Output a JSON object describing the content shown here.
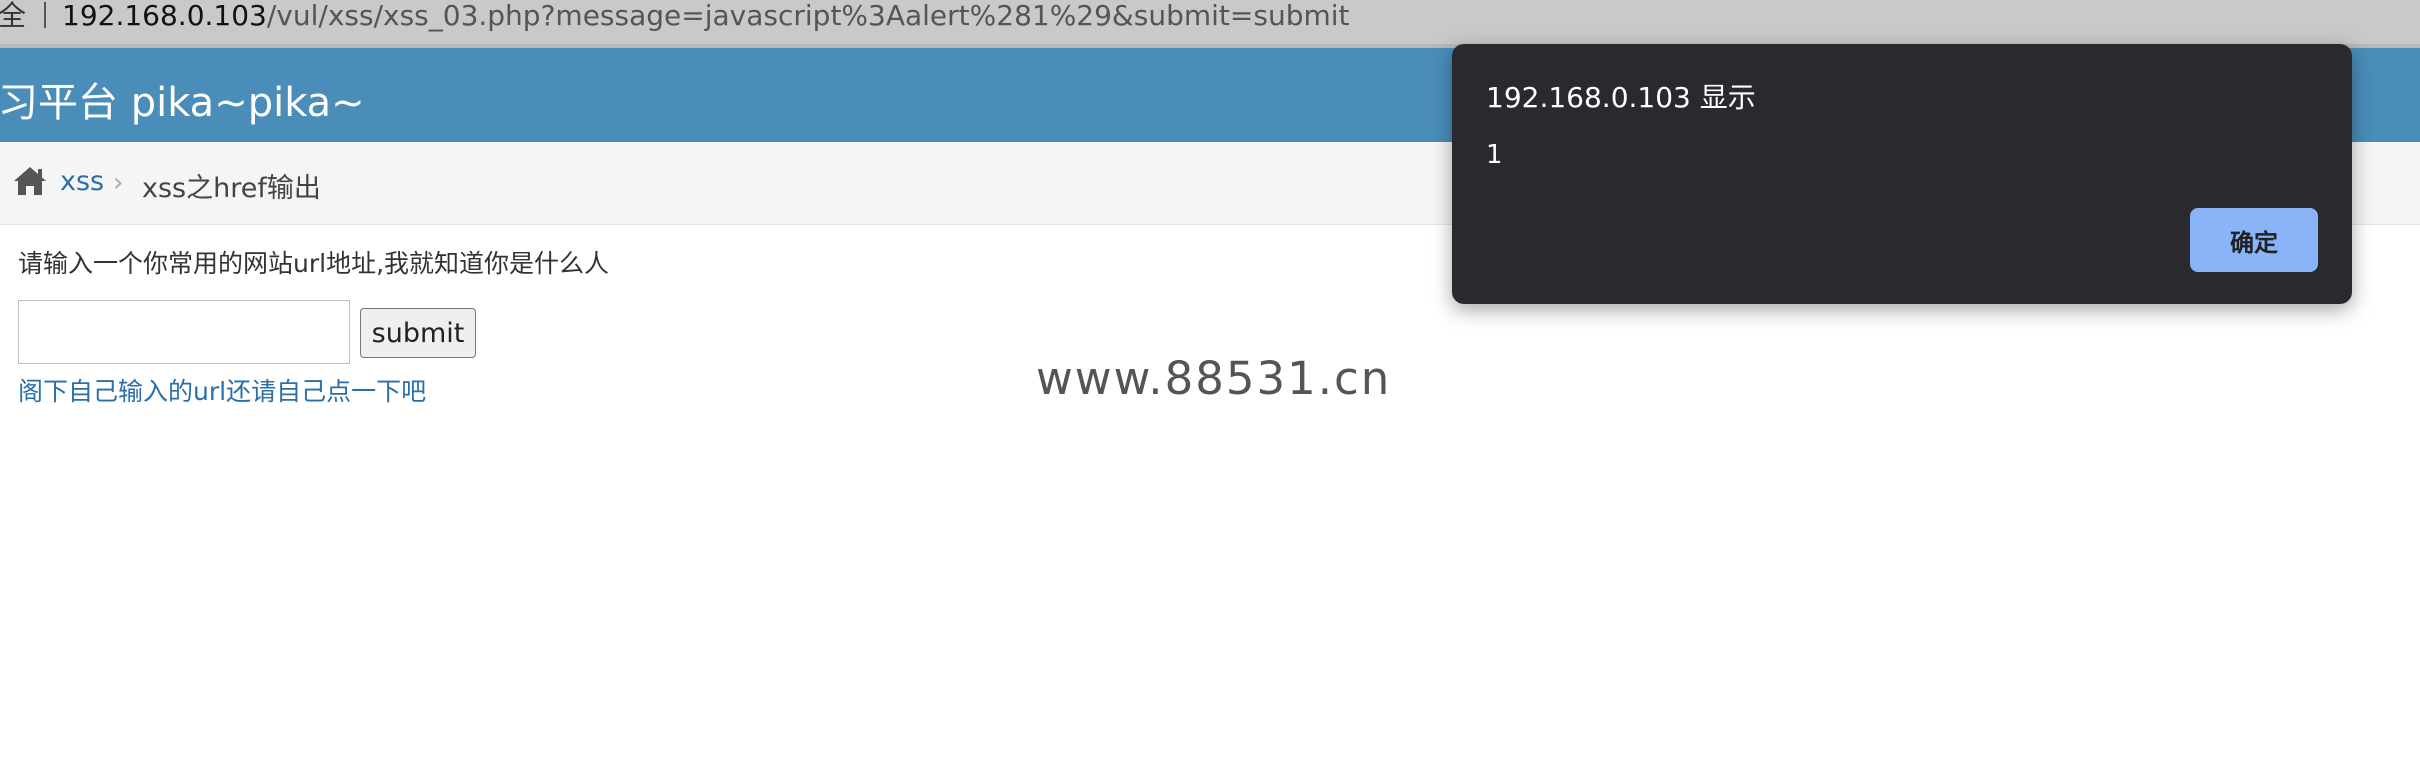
{
  "address_bar": {
    "prefix": "全",
    "host": "192.168.0.103",
    "path": "/vul/xss/xss_03.php?message=javascript%3Aalert%281%29&submit=submit"
  },
  "header": {
    "title": "习平台 pika~pika~"
  },
  "breadcrumb": {
    "home_icon": "home-icon",
    "link": "xss",
    "separator": "›",
    "current": "xss之href输出"
  },
  "main": {
    "prompt": "请输入一个你常用的网站url地址,我就知道你是什么人",
    "input_value": "",
    "submit_label": "submit",
    "result_link": "阁下自己输入的url还请自己点一下吧"
  },
  "watermark": "www.88531.cn",
  "dialog": {
    "title": "192.168.0.103 显示",
    "message": "1",
    "ok_label": "确定",
    "ok_color": "#8ab4f8",
    "background": "#2a2a2e"
  },
  "colors": {
    "header": "#4a8db8",
    "link": "#2a6fa8"
  }
}
